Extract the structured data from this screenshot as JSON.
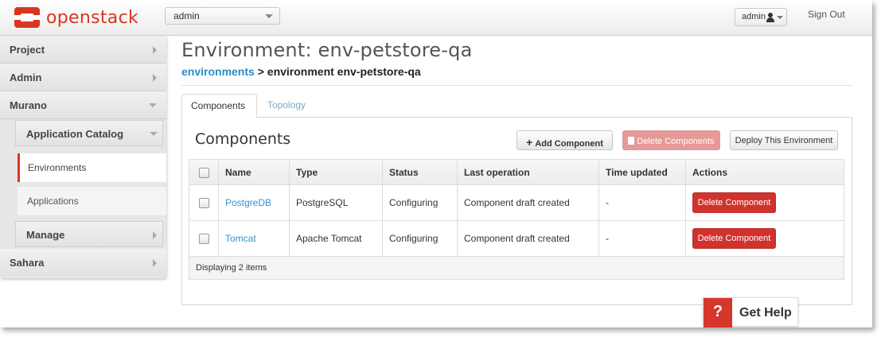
{
  "brand": {
    "name": "openstack",
    "color": "#d9361f"
  },
  "topbar": {
    "project_select": "admin",
    "user_menu": "admin",
    "sign_out": "Sign Out"
  },
  "sidebar": {
    "items": [
      {
        "label": "Project",
        "state": "collapsed"
      },
      {
        "label": "Admin",
        "state": "collapsed"
      },
      {
        "label": "Murano",
        "state": "expanded"
      },
      {
        "label": "Sahara",
        "state": "collapsed"
      }
    ],
    "murano": {
      "application_catalog": "Application Catalog",
      "links": [
        "Environments",
        "Applications"
      ],
      "active_link": "Environments",
      "manage": "Manage"
    }
  },
  "page": {
    "title": "Environment: env-petstore-qa",
    "breadcrumb": {
      "link": "environments",
      "separator": ">",
      "current": "environment env-petstore-qa"
    }
  },
  "tabs": [
    {
      "label": "Components",
      "active": true
    },
    {
      "label": "Topology",
      "active": false
    }
  ],
  "components_panel": {
    "title": "Components",
    "buttons": {
      "add": "Add Component",
      "delete": "Delete Components",
      "deploy": "Deploy This Environment"
    },
    "table": {
      "columns": [
        "Name",
        "Type",
        "Status",
        "Last operation",
        "Time updated",
        "Actions"
      ],
      "rows": [
        {
          "name": "PostgreDB",
          "type": "PostgreSQL",
          "status": "Configuring",
          "last_operation": "Component draft created",
          "time_updated": "-",
          "action": "Delete Component"
        },
        {
          "name": "Tomcat",
          "type": "Apache Tomcat",
          "status": "Configuring",
          "last_operation": "Component draft created",
          "time_updated": "-",
          "action": "Delete Component"
        }
      ],
      "footer": "Displaying 2 items"
    }
  },
  "help_widget": {
    "icon": "?",
    "label": "Get Help"
  },
  "colors": {
    "accent": "#d9361f",
    "link": "#2a8cc4",
    "danger": "#d2322d"
  }
}
